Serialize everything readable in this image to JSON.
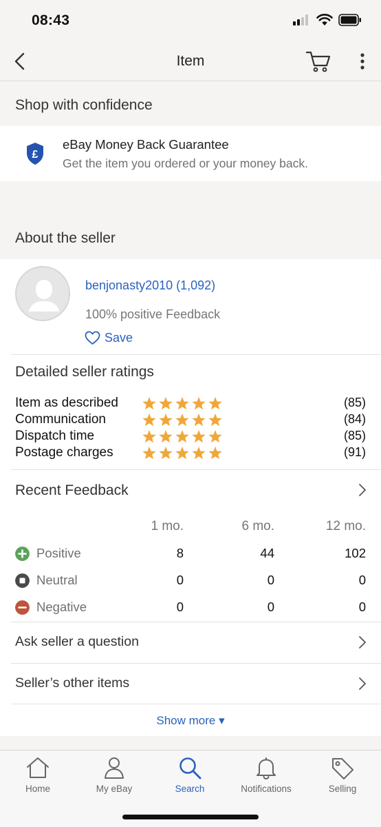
{
  "status_bar": {
    "time": "08:43"
  },
  "nav": {
    "title": "Item"
  },
  "confidence": {
    "heading": "Shop with confidence",
    "guarantee_title": "eBay Money Back Guarantee",
    "guarantee_sub": "Get the item you ordered or your money back."
  },
  "seller": {
    "heading": "About the seller",
    "name": "benjonasty2010 (1,092)",
    "feedback_pct": "100% positive Feedback",
    "save_label": "Save"
  },
  "dsr": {
    "title": "Detailed seller ratings",
    "rows": [
      {
        "label": "Item as described",
        "stars": 5,
        "count": "(85)"
      },
      {
        "label": "Communication",
        "stars": 5,
        "count": "(84)"
      },
      {
        "label": "Dispatch time",
        "stars": 5,
        "count": "(85)"
      },
      {
        "label": "Postage charges",
        "stars": 5,
        "count": "(91)"
      }
    ],
    "star_color": "#f0a73a"
  },
  "recent_feedback": {
    "title": "Recent Feedback",
    "columns": [
      "1 mo.",
      "6 mo.",
      "12 mo."
    ],
    "rows": [
      {
        "label": "Positive",
        "icon": "plus-circle-icon",
        "color": "#5ba35b",
        "values": [
          "8",
          "44",
          "102"
        ]
      },
      {
        "label": "Neutral",
        "icon": "neutral-circle-icon",
        "color": "#4a4a4a",
        "values": [
          "0",
          "0",
          "0"
        ]
      },
      {
        "label": "Negative",
        "icon": "minus-circle-icon",
        "color": "#c0533d",
        "values": [
          "0",
          "0",
          "0"
        ]
      }
    ]
  },
  "links": {
    "ask_question": "Ask seller a question",
    "other_items": "Seller’s other items",
    "show_more": "Show more ▾"
  },
  "tabs": [
    {
      "label": "Home",
      "icon": "home-icon"
    },
    {
      "label": "My eBay",
      "icon": "person-icon"
    },
    {
      "label": "Search",
      "icon": "search-icon",
      "active": true
    },
    {
      "label": "Notifications",
      "icon": "bell-icon"
    },
    {
      "label": "Selling",
      "icon": "tag-icon"
    }
  ],
  "colors": {
    "link": "#2a62c0",
    "accent": "#2a62c0",
    "background": "#f5f4f2"
  }
}
